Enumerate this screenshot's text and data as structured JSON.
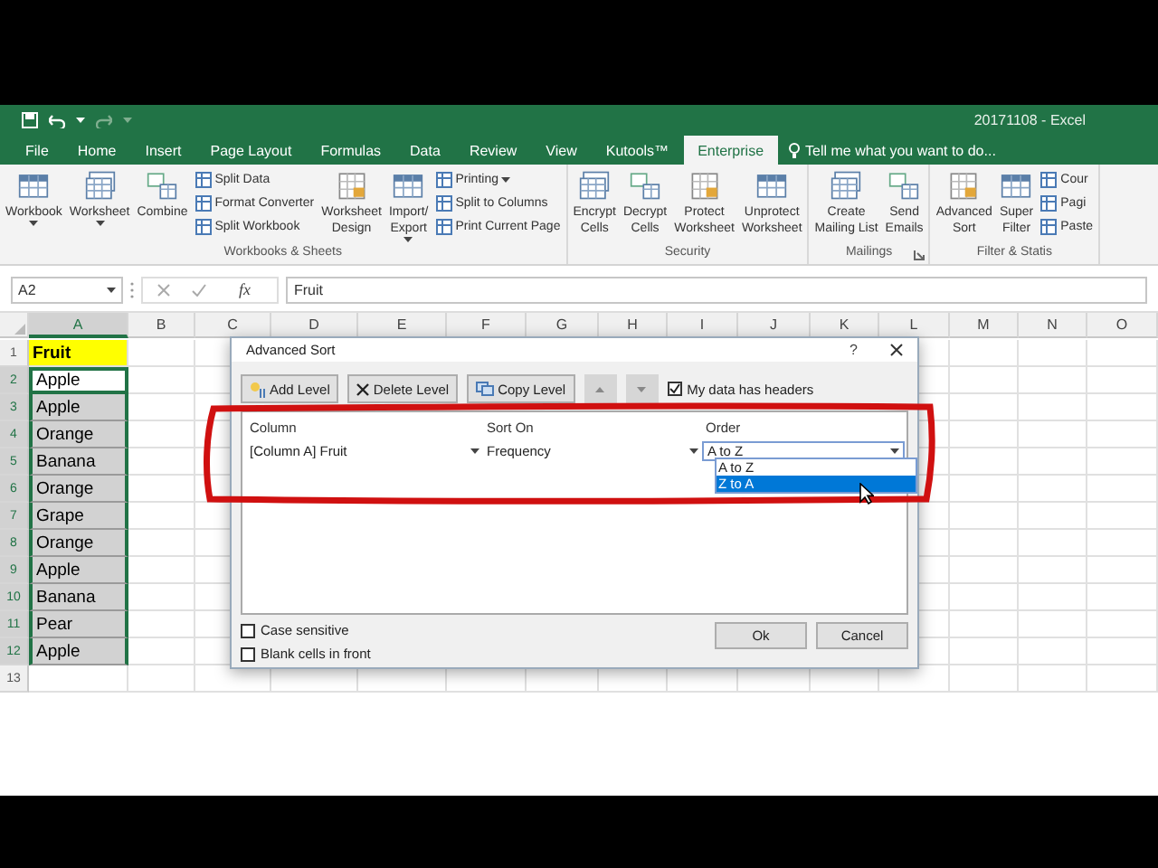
{
  "window": {
    "title": "20171108 - Excel"
  },
  "tabs": [
    {
      "label": "File",
      "selected": false
    },
    {
      "label": "Home",
      "selected": false
    },
    {
      "label": "Insert",
      "selected": false
    },
    {
      "label": "Page Layout",
      "selected": false
    },
    {
      "label": "Formulas",
      "selected": false
    },
    {
      "label": "Data",
      "selected": false
    },
    {
      "label": "Review",
      "selected": false
    },
    {
      "label": "View",
      "selected": false
    },
    {
      "label": "Kutools™",
      "selected": false
    },
    {
      "label": "Enterprise",
      "selected": true
    }
  ],
  "tell_me": {
    "placeholder": "Tell me what you want to do..."
  },
  "ribbon": {
    "groups": [
      {
        "label": "Workbooks & Sheets",
        "items": [
          {
            "kind": "large",
            "label": "Workbook",
            "dropdown": true
          },
          {
            "kind": "large",
            "label": "Worksheet",
            "dropdown": true
          },
          {
            "kind": "large",
            "label": "Combine"
          },
          {
            "kind": "stack",
            "items": [
              {
                "label": "Split Data"
              },
              {
                "label": "Format Converter"
              },
              {
                "label": "Split Workbook"
              }
            ]
          },
          {
            "kind": "large",
            "label": "Worksheet\nDesign"
          },
          {
            "kind": "large",
            "label": "Import/\nExport",
            "dropdown": true
          },
          {
            "kind": "stack",
            "items": [
              {
                "label": "Printing",
                "dropdown": true
              },
              {
                "label": "Split to Columns"
              },
              {
                "label": "Print Current Page"
              }
            ]
          }
        ]
      },
      {
        "label": "Security",
        "items": [
          {
            "kind": "large",
            "label": "Encrypt\nCells"
          },
          {
            "kind": "large",
            "label": "Decrypt\nCells"
          },
          {
            "kind": "large",
            "label": "Protect\nWorksheet"
          },
          {
            "kind": "large",
            "label": "Unprotect\nWorksheet"
          }
        ]
      },
      {
        "label": "Mailings",
        "launcher": true,
        "items": [
          {
            "kind": "large",
            "label": "Create\nMailing List"
          },
          {
            "kind": "large",
            "label": "Send\nEmails"
          }
        ]
      },
      {
        "label": "Filter & Statis",
        "items": [
          {
            "kind": "large",
            "label": "Advanced\nSort"
          },
          {
            "kind": "large",
            "label": "Super\nFilter"
          },
          {
            "kind": "stack",
            "items": [
              {
                "label": "Cour"
              },
              {
                "label": "Pagi"
              },
              {
                "label": "Paste"
              }
            ]
          }
        ]
      }
    ]
  },
  "formula_bar": {
    "name_box": "A2",
    "function_label": "fx",
    "formula": "Fruit"
  },
  "sheet": {
    "columns": [
      "A",
      "B",
      "C",
      "D",
      "E",
      "F",
      "G",
      "H",
      "I",
      "J",
      "K",
      "L",
      "M",
      "N",
      "O"
    ],
    "rows": [
      {
        "number": "1",
        "value": "Fruit",
        "kind": "header",
        "selected": false,
        "active": false
      },
      {
        "number": "2",
        "value": "Apple",
        "kind": "data",
        "selected": true,
        "active": true
      },
      {
        "number": "3",
        "value": "Apple",
        "kind": "data",
        "selected": true,
        "active": false
      },
      {
        "number": "4",
        "value": "Orange",
        "kind": "data",
        "selected": true,
        "active": false
      },
      {
        "number": "5",
        "value": "Banana",
        "kind": "data",
        "selected": true,
        "active": false
      },
      {
        "number": "6",
        "value": "Orange",
        "kind": "data",
        "selected": true,
        "active": false
      },
      {
        "number": "7",
        "value": "Grape",
        "kind": "data",
        "selected": true,
        "active": false
      },
      {
        "number": "8",
        "value": "Orange",
        "kind": "data",
        "selected": true,
        "active": false
      },
      {
        "number": "9",
        "value": "Apple",
        "kind": "data",
        "selected": true,
        "active": false
      },
      {
        "number": "10",
        "value": "Banana",
        "kind": "data",
        "selected": true,
        "active": false
      },
      {
        "number": "11",
        "value": "Pear",
        "kind": "data",
        "selected": true,
        "active": false
      },
      {
        "number": "12",
        "value": "Apple",
        "kind": "data",
        "selected": true,
        "active": false
      },
      {
        "number": "13",
        "kind": "empty",
        "selected": false,
        "active": false
      }
    ]
  },
  "dialog": {
    "title": "Advanced Sort",
    "help": "?",
    "toolbar": [
      {
        "kind": "add",
        "label": "Add Level"
      },
      {
        "kind": "delete",
        "label": "Delete Level"
      },
      {
        "kind": "copy",
        "label": "Copy Level"
      },
      {
        "kind": "up"
      },
      {
        "kind": "down"
      }
    ],
    "headers_checkbox": {
      "label": "My data has headers",
      "checked": true
    },
    "columns": [
      "Column",
      "Sort On",
      "Order"
    ],
    "levels": [
      {
        "column": "[Column A] Fruit",
        "sort_on": "Frequency",
        "order": "A to Z"
      }
    ],
    "order_options": [
      {
        "label": "A to Z",
        "selected": false
      },
      {
        "label": "Z to A",
        "selected": true
      }
    ],
    "options": [
      {
        "label": "Case sensitive",
        "checked": false
      },
      {
        "label": "Blank cells in front",
        "checked": false
      }
    ],
    "buttons": [
      "Ok",
      "Cancel"
    ]
  }
}
